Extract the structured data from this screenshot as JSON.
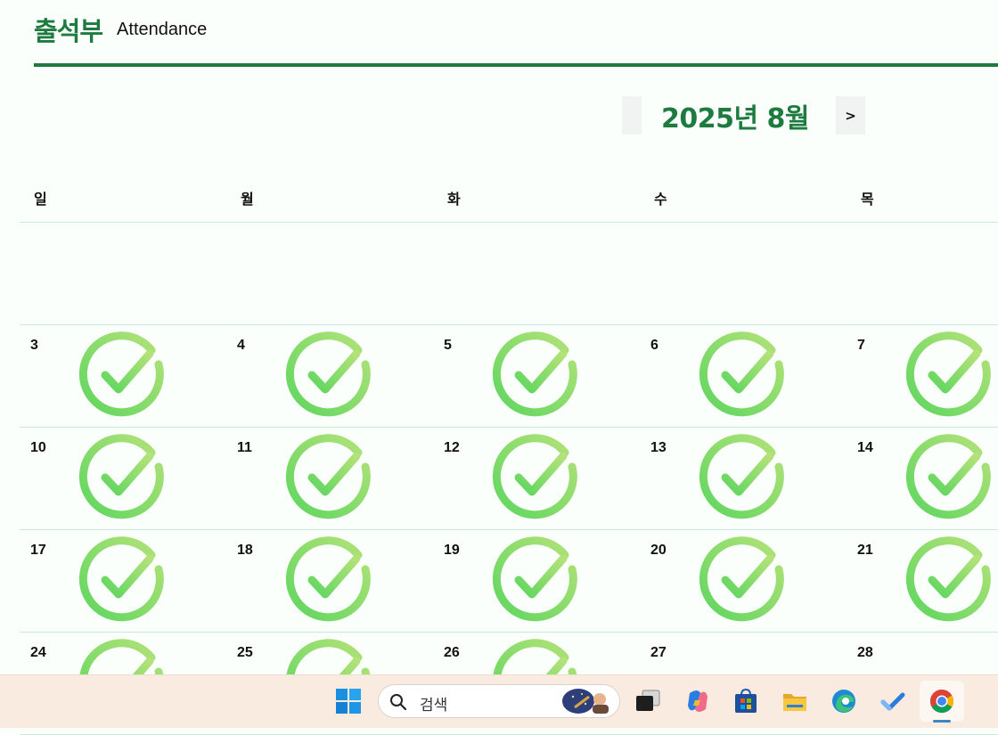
{
  "header": {
    "title": "출석부",
    "subtitle": "Attendance"
  },
  "nav": {
    "prev_label": "",
    "month_label": "2025년 8월",
    "next_label": ">"
  },
  "weekdays": [
    "일",
    "월",
    "화",
    "수",
    "목"
  ],
  "weeks": [
    {
      "days": [
        "3",
        "4",
        "5",
        "6",
        "7"
      ],
      "checked": [
        true,
        true,
        true,
        true,
        true
      ]
    },
    {
      "days": [
        "10",
        "11",
        "12",
        "13",
        "14"
      ],
      "checked": [
        true,
        true,
        true,
        true,
        true
      ]
    },
    {
      "days": [
        "17",
        "18",
        "19",
        "20",
        "21"
      ],
      "checked": [
        true,
        true,
        true,
        true,
        true
      ]
    },
    {
      "days": [
        "24",
        "25",
        "26",
        "27",
        "28"
      ],
      "checked": [
        true,
        true,
        true,
        false,
        false
      ]
    }
  ],
  "taskbar": {
    "search_placeholder": "검색",
    "apps": [
      "windows-start-icon",
      "task-view-icon",
      "copilot-icon",
      "store-icon",
      "file-explorer-icon",
      "edge-icon",
      "todo-icon",
      "chrome-icon"
    ]
  },
  "colors": {
    "accent": "#1e7b3f",
    "check_light": "#b4e27a",
    "check_dark": "#5fd65f",
    "grid_line": "#c8ead6"
  }
}
